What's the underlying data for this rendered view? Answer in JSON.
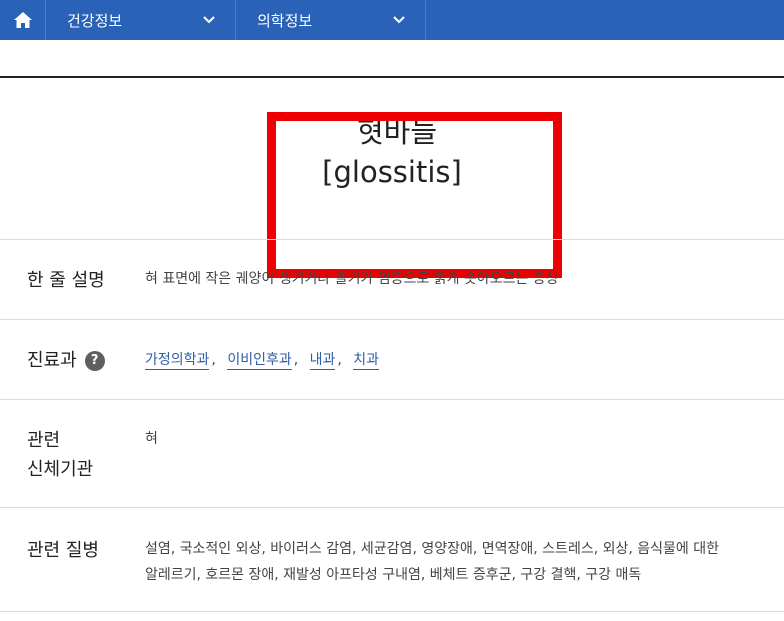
{
  "nav": {
    "items": [
      {
        "label": "건강정보"
      },
      {
        "label": "의학정보"
      }
    ]
  },
  "title": {
    "ko": "혓바늘",
    "en": "[glossitis]"
  },
  "rows": {
    "summary": {
      "label": "한 줄 설명",
      "value": "혀 표면에 작은 궤양이 생기거나 돌기가 염증으로 붉게 솟아오르는 증상"
    },
    "department": {
      "label": "진료과",
      "help": "?",
      "links": [
        "가정의학과",
        "이비인후과",
        "내과",
        "치과"
      ],
      "separator": ","
    },
    "organ": {
      "label_line1": "관련",
      "label_line2": "신체기관",
      "value": "혀"
    },
    "disease": {
      "label": "관련 질병",
      "line1": "설염, 국소적인 외상, 바이러스 감염, 세균감염, 영양장애, 면역장애, 스트레스, 외상, 음식물에 대한",
      "line2": "알레르기, 호르몬 장애, 재발성 아프타성 구내염, 베체트 증후군, 구강 결핵, 구강 매독"
    }
  },
  "colors": {
    "nav_bg": "#2a62b8",
    "highlight": "#ee0000",
    "link": "#2f5ea8"
  }
}
